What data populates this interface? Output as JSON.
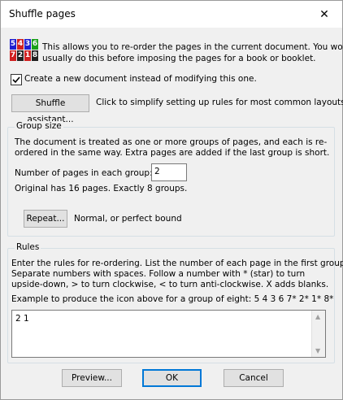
{
  "dialog": {
    "title": "Shuffle pages",
    "close_glyph": "✕"
  },
  "intro": {
    "icon_name": "page-order-icon",
    "icon_cells": [
      "5",
      "4",
      "3",
      "6",
      "7",
      "2",
      "1",
      "8"
    ],
    "line1": "This allows you to re-order the pages in the current document. You would",
    "line2": "usually do this before imposing the pages for a book or booklet."
  },
  "new_doc": {
    "checked": true,
    "label": "Create a new document instead of modifying this one."
  },
  "assistant": {
    "button_label": "Shuffle assistant...",
    "hint": "Click to simplify setting up rules for most common layouts"
  },
  "group_size": {
    "legend": "Group size",
    "desc1": "The document is treated as one or more groups of pages, and each is re-",
    "desc2": "ordered in the same way. Extra pages are added if the last group is short.",
    "pages_label": "Number of pages in each group:",
    "pages_value": "2",
    "summary": "Original has 16 pages. Exactly 8 groups.",
    "repeat_button": "Repeat...",
    "repeat_mode": "Normal, or perfect bound"
  },
  "rules": {
    "legend": "Rules",
    "desc1": "Enter the rules for re-ordering. List the number of each page in the first group.",
    "desc2": "Separate numbers with spaces. Follow a number with * (star)  to turn",
    "desc3": "upside-down, > to turn clockwise, < to turn anti-clockwise. X adds blanks.",
    "example": "Example to produce the icon above for a group of eight: 5 4 3 6 7* 2* 1* 8*",
    "value": "2 1"
  },
  "footer": {
    "preview": "Preview...",
    "ok": "OK",
    "cancel": "Cancel"
  },
  "colors": {
    "accent": "#0078d7",
    "icon_cells": [
      "#1f1fd0",
      "#d02020",
      "#1f1fd0",
      "#18a018",
      "#d02020",
      "#202020",
      "#d02020",
      "#202020"
    ]
  }
}
